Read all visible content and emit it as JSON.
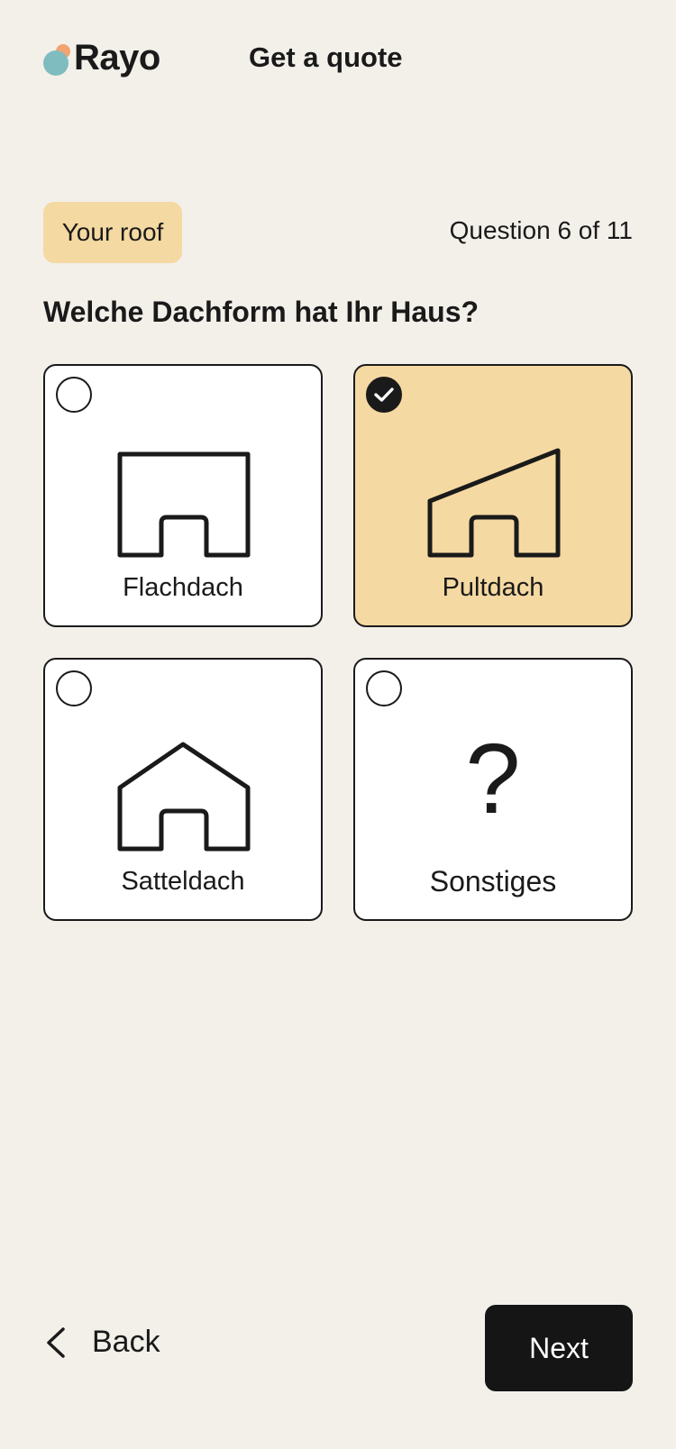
{
  "header": {
    "logo_text": "Rayo",
    "title": "Get a quote"
  },
  "progress": {
    "section": "Your roof",
    "counter": "Question 6 of 11",
    "current": 6,
    "total": 11
  },
  "question": {
    "text": "Welche Dachform hat Ihr Haus?"
  },
  "options": [
    {
      "label": "Flachdach",
      "icon": "flat-roof-house-icon",
      "selected": false
    },
    {
      "label": "Pultdach",
      "icon": "shed-roof-house-icon",
      "selected": true
    },
    {
      "label": "Satteldach",
      "icon": "gable-roof-house-icon",
      "selected": false
    },
    {
      "label": "Sonstiges",
      "icon": "question-mark-icon",
      "glyph": "?",
      "selected": false
    }
  ],
  "footer": {
    "back_label": "Back",
    "next_label": "Next"
  },
  "colors": {
    "background": "#f3f0ea",
    "accent": "#f5d9a2",
    "logo_orange": "#f2a46f",
    "logo_teal": "#7fbcc0",
    "primary_button": "#151515"
  }
}
